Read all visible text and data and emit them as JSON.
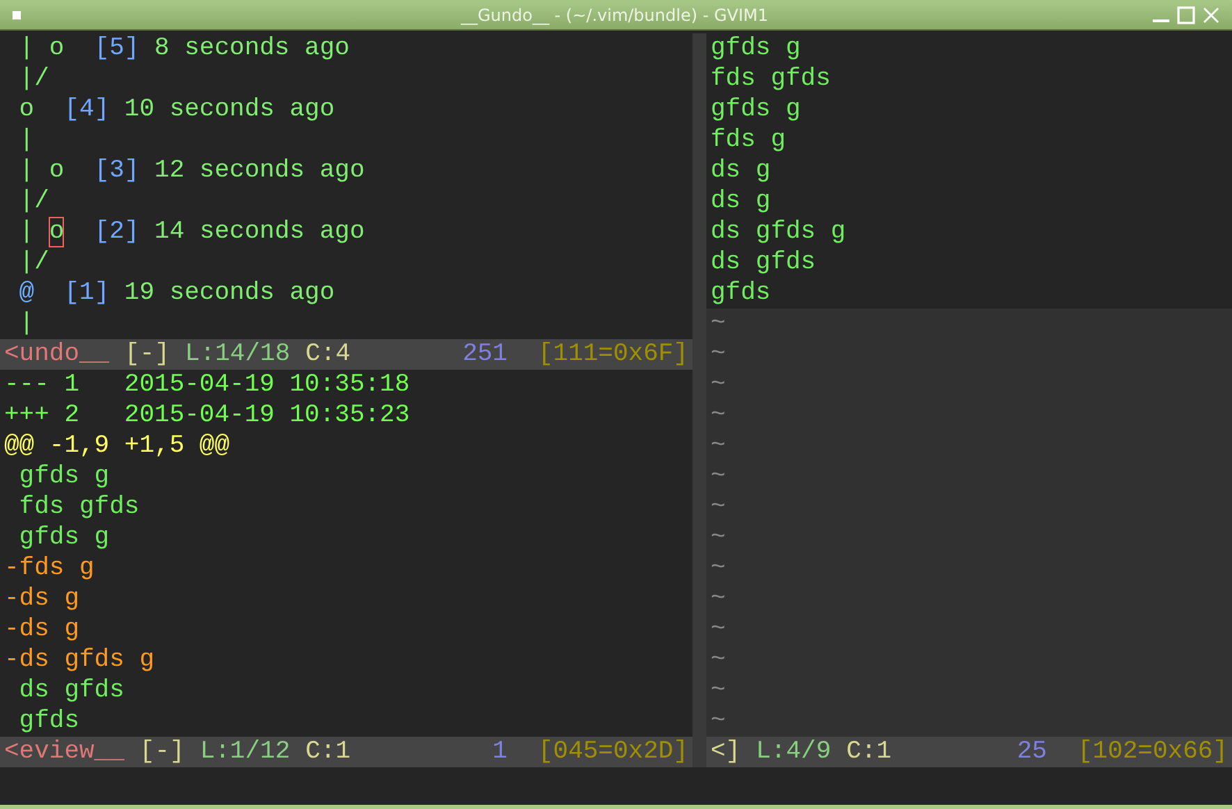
{
  "window": {
    "title": "__Gundo__ - (~/.vim/bundle) - GVIM1"
  },
  "undo_tree": {
    "lines": [
      [
        {
          "text": " | o  ",
          "kind": "graph"
        },
        {
          "text": "[5]",
          "kind": "seq"
        },
        {
          "text": " 8 seconds ago",
          "kind": "time"
        }
      ],
      [
        {
          "text": " |/",
          "kind": "graph"
        }
      ],
      [
        {
          "text": " o  ",
          "kind": "graph"
        },
        {
          "text": "[4]",
          "kind": "seq"
        },
        {
          "text": " 10 seconds ago",
          "kind": "time"
        }
      ],
      [
        {
          "text": " |",
          "kind": "graph"
        }
      ],
      [
        {
          "text": " | o  ",
          "kind": "graph"
        },
        {
          "text": "[3]",
          "kind": "seq"
        },
        {
          "text": " 12 seconds ago",
          "kind": "time"
        }
      ],
      [
        {
          "text": " |/",
          "kind": "graph"
        }
      ],
      [
        {
          "text": " | ",
          "kind": "graph"
        },
        {
          "text": "o",
          "kind": "cursor"
        },
        {
          "text": "  [2]",
          "kind": "seq"
        },
        {
          "text": " 14 seconds ago",
          "kind": "time"
        }
      ],
      [
        {
          "text": " |/",
          "kind": "graph"
        }
      ],
      [
        {
          "text": " @",
          "kind": "current"
        },
        {
          "text": "  [1]",
          "kind": "seq"
        },
        {
          "text": " 19 seconds ago",
          "kind": "time"
        }
      ],
      [
        {
          "text": " |",
          "kind": "graph"
        }
      ]
    ],
    "status": [
      {
        "text": "<undo__",
        "kind": "name"
      },
      {
        "text": "[-]",
        "kind": "flag"
      },
      {
        "text": "L:14/18",
        "kind": "line"
      },
      {
        "text": "C:4",
        "kind": "col"
      },
      {
        "text": "251",
        "kind": "byte"
      },
      {
        "text": "[111=0x6F]",
        "kind": "char"
      }
    ]
  },
  "preview": {
    "lines": [
      {
        "text": "--- 1   2015-04-19 10:35:18",
        "kind": "header"
      },
      {
        "text": "+++ 2   2015-04-19 10:35:23",
        "kind": "header"
      },
      {
        "text": "@@ -1,9 +1,5 @@",
        "kind": "hunk"
      },
      {
        "text": " gfds g",
        "kind": "context"
      },
      {
        "text": " fds gfds",
        "kind": "context"
      },
      {
        "text": " gfds g",
        "kind": "context"
      },
      {
        "text": "-fds g",
        "kind": "removed"
      },
      {
        "text": "-ds g",
        "kind": "removed"
      },
      {
        "text": "-ds g",
        "kind": "removed"
      },
      {
        "text": "-ds gfds g",
        "kind": "removed"
      },
      {
        "text": " ds gfds",
        "kind": "context"
      },
      {
        "text": " gfds",
        "kind": "context"
      }
    ],
    "status": [
      {
        "text": "<eview__",
        "kind": "name"
      },
      {
        "text": "[-]",
        "kind": "flag"
      },
      {
        "text": "L:1/12",
        "kind": "line"
      },
      {
        "text": "C:1",
        "kind": "col"
      },
      {
        "text": "1",
        "kind": "byte"
      },
      {
        "text": "[045=0x2D]",
        "kind": "char"
      }
    ]
  },
  "buffer": {
    "lines": [
      "gfds g",
      "fds gfds",
      "gfds g",
      "fds g",
      "ds g",
      "ds g",
      "ds gfds g",
      "ds gfds",
      "gfds"
    ],
    "filler": [
      "~",
      "~",
      "~",
      "~",
      "~",
      "~",
      "~",
      "~",
      "~",
      "~",
      "~",
      "~",
      "~",
      "~"
    ],
    "status": [
      {
        "text": "<]",
        "kind": "flag"
      },
      {
        "text": "L:4/9",
        "kind": "line"
      },
      {
        "text": "C:1",
        "kind": "col"
      },
      {
        "text": "25",
        "kind": "byte"
      },
      {
        "text": "[102=0x66]",
        "kind": "char"
      }
    ]
  }
}
